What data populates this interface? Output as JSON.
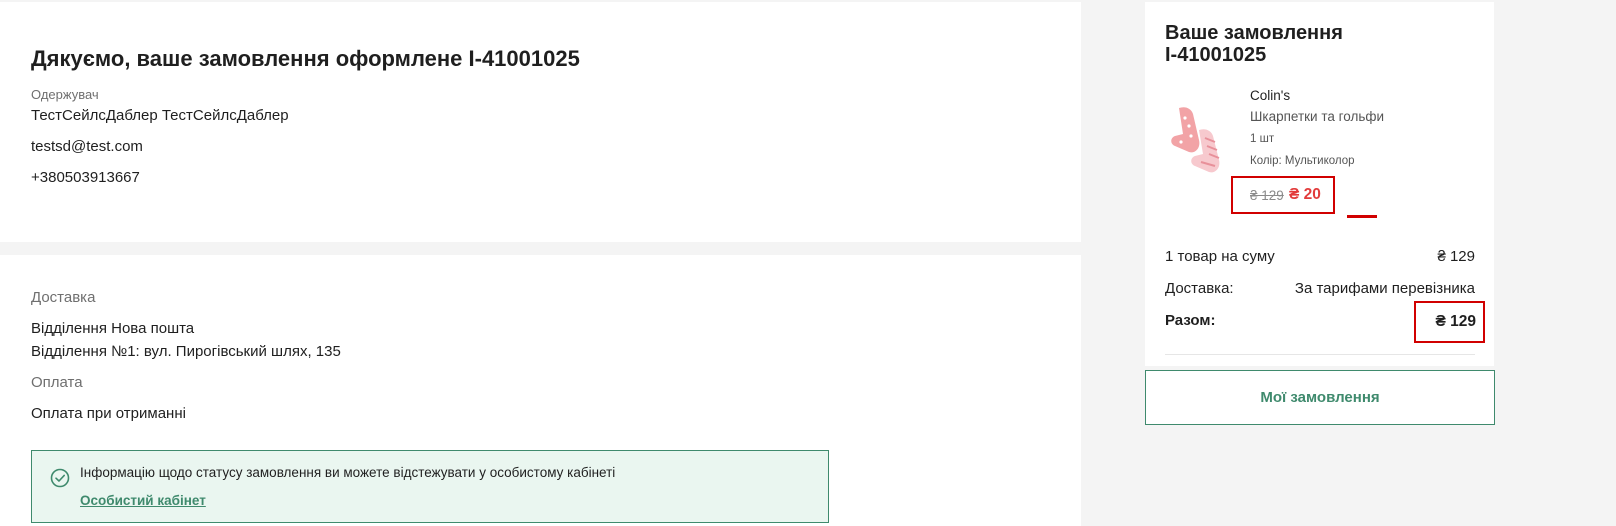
{
  "confirmation": {
    "title": "Дякуємо, ваше замовлення оформлене I-41001025",
    "recipient_label": "Одержувач",
    "recipient_name": "ТестСейлсДаблер ТестСейлсДаблер",
    "email": "testsd@test.com",
    "phone": "+380503913667"
  },
  "delivery": {
    "label": "Доставка",
    "method": "Відділення Нова пошта",
    "address": "Відділення №1: вул. Пирогівський шлях, 135"
  },
  "payment": {
    "label": "Оплата",
    "method": "Оплата при отриманні"
  },
  "info_box": {
    "text": "Інформацію щодо статусу замовлення ви можете відстежувати у особистому кабінеті",
    "link_label": "Особистий кабінет",
    "icon": "check-circle-icon"
  },
  "order_summary": {
    "title_line1": "Ваше замовлення",
    "title_line2": "I-41001025",
    "item": {
      "brand": "Colin's",
      "name": "Шкарпетки та гольфи",
      "quantity": "1 шт",
      "color": "Колір: Мультиколор",
      "old_price": "₴ 129",
      "new_price": "₴ 20",
      "image_icon": "socks-image"
    },
    "subtotal_label": "1 товар на суму",
    "subtotal_value": "₴ 129",
    "delivery_label": "Доставка:",
    "delivery_value": "За тарифами перевізника",
    "total_label": "Разом:",
    "total_value": "₴ 129"
  },
  "buttons": {
    "my_orders": "Мої замовлення"
  },
  "colors": {
    "accent": "#3f8a6d",
    "highlight": "#d10000",
    "sale_price": "#e23b3b",
    "background": "#f4f4f4"
  }
}
